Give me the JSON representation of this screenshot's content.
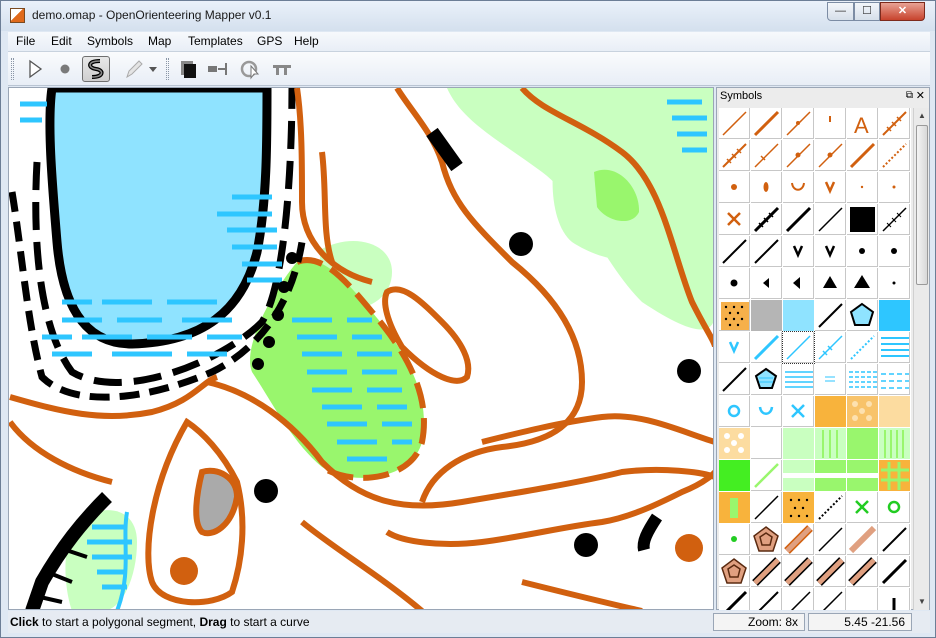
{
  "window": {
    "title": "demo.omap - OpenOrienteering Mapper v0.1",
    "minimize_glyph": "—",
    "maximize_glyph": "☐",
    "close_glyph": "✕"
  },
  "menu": [
    "File",
    "Edit",
    "Symbols",
    "Map",
    "Templates",
    "GPS",
    "Help"
  ],
  "toolbar": {
    "tools": [
      "edit-tool",
      "draw-point-tool",
      "draw-path-tool",
      "pencil-tool",
      "fill-tool",
      "cut-tool",
      "rotate-tool",
      "split-tool"
    ],
    "active_tool": "draw-path-tool"
  },
  "symbols_panel": {
    "title": "Symbols",
    "float_glyph": "⧉",
    "close_glyph": "✕"
  },
  "status": {
    "click_label": "Click",
    "click_text": " to start a polygonal segment, ",
    "drag_label": "Drag",
    "drag_text": " to start a curve",
    "zoom": "Zoom: 8x",
    "coords": "5.45 -21.56"
  },
  "colors": {
    "contour": "#d1600f",
    "water": "#2ec6ff",
    "lake": "#8fe3ff",
    "vegetation": "#99f66d",
    "open_light": "#c9ffc0",
    "black": "#000000"
  }
}
